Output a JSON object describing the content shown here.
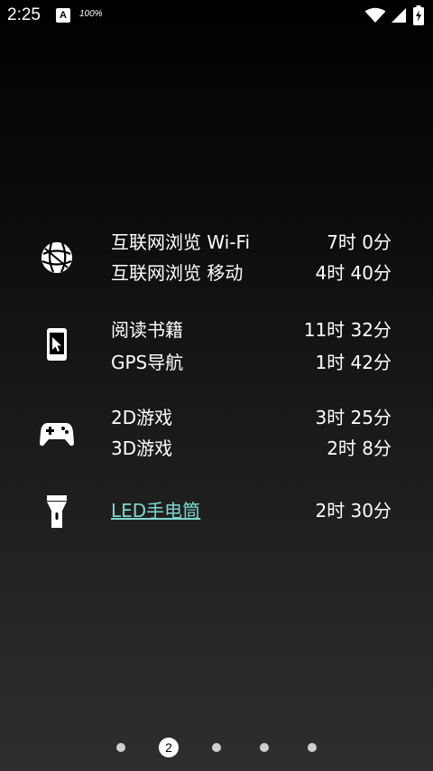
{
  "status_bar": {
    "time": "2:25",
    "notification_letter": "A",
    "battery_percent": "100%",
    "icons": [
      "wifi-icon",
      "signal-icon",
      "battery-charging-icon"
    ]
  },
  "groups": [
    {
      "icon": "globe-icon",
      "rows": [
        {
          "label": "互联网浏览 Wi-Fi",
          "value": "7时 0分"
        },
        {
          "label": "互联网浏览 移动",
          "value": "4时 40分"
        }
      ]
    },
    {
      "icon": "tablet-touch-icon",
      "rows": [
        {
          "label": "阅读书籍",
          "value": "11时 32分"
        },
        {
          "label": "GPS导航",
          "value": "1时 42分"
        }
      ]
    },
    {
      "icon": "gamepad-icon",
      "rows": [
        {
          "label": "2D游戏",
          "value": "3时 25分"
        },
        {
          "label": "3D游戏",
          "value": "2时 8分"
        }
      ]
    },
    {
      "icon": "flashlight-icon",
      "rows": [
        {
          "label": "LED手电筒",
          "value": "2时 30分"
        }
      ]
    }
  ],
  "pager": {
    "active_page": "2",
    "total_pages": 5
  }
}
